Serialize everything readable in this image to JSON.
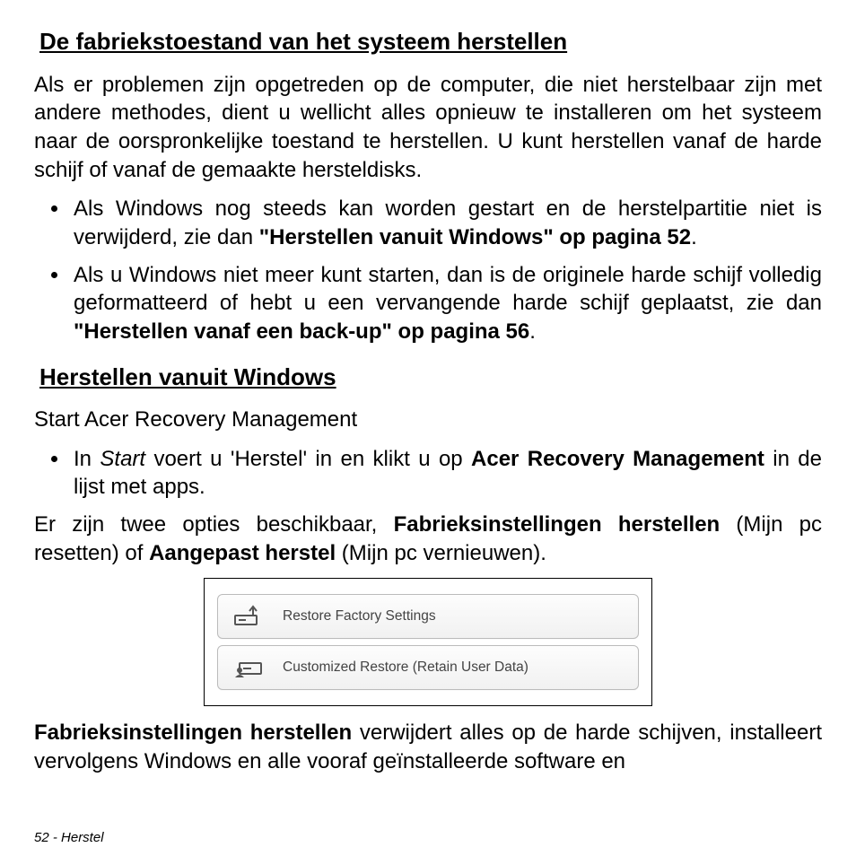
{
  "heading1": "De fabriekstoestand van het systeem herstellen",
  "para1": "Als er problemen zijn opgetreden op de computer, die niet herstelbaar zijn met andere methodes, dient u wellicht alles opnieuw te installeren om het systeem naar de oorspronkelijke toestand te herstellen. U kunt herstellen vanaf de harde schijf of vanaf de gemaakte hersteldisks.",
  "bullet1_a": "Als Windows nog steeds kan worden gestart en de herstelpartitie niet is verwijderd, zie dan ",
  "bullet1_b": "\"Herstellen vanuit Windows\" op pagina 52",
  "bullet1_c": ".",
  "bullet2_a": "Als u Windows niet meer kunt starten, dan is de originele harde schijf volledig geformatteerd of hebt u een vervangende harde schijf geplaatst, zie dan ",
  "bullet2_b": "\"Herstellen vanaf een back-up\" op pagina 56",
  "bullet2_c": ".",
  "heading2": "Herstellen vanuit Windows",
  "para2": "Start Acer Recovery Management",
  "bullet3_a": "In ",
  "bullet3_b": "Start",
  "bullet3_c": " voert u 'Herstel' in en klikt u op ",
  "bullet3_d": "Acer Recovery Management",
  "bullet3_e": " in de lijst met apps.",
  "para3_a": "Er zijn twee opties beschikbaar, ",
  "para3_b": "Fabrieksinstellingen herstellen",
  "para3_c": " (Mijn pc resetten) of ",
  "para3_d": "Aangepast herstel",
  "para3_e": " (Mijn pc vernieuwen).",
  "btn1": "Restore Factory Settings",
  "btn2": "Customized Restore (Retain User Data)",
  "para4_a": "Fabrieksinstellingen herstellen",
  "para4_b": " verwijdert alles op de harde schijven, installeert vervolgens Windows en alle vooraf geïnstalleerde software en",
  "footer": "52 - Herstel"
}
